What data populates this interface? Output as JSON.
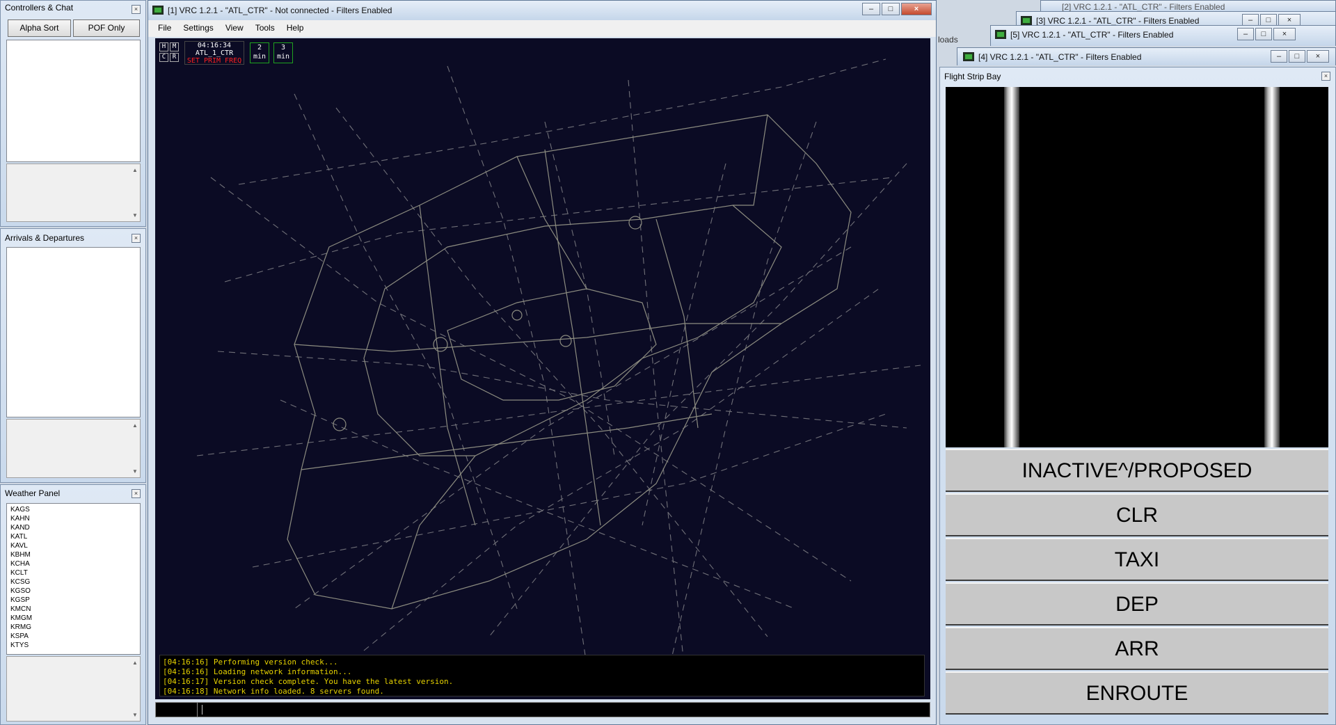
{
  "left_panels": {
    "controllers": {
      "title": "Controllers & Chat",
      "sort_alpha": "Alpha Sort",
      "pof_only": "POF Only"
    },
    "arrivals": {
      "title": "Arrivals & Departures"
    },
    "weather": {
      "title": "Weather Panel",
      "airports": [
        "KAGS",
        "KAHN",
        "KAND",
        "KATL",
        "KAVL",
        "KBHM",
        "KCHA",
        "KCLT",
        "KCSG",
        "KGSO",
        "KGSP",
        "KMCN",
        "KMGM",
        "KRMG",
        "KSPA",
        "KTYS"
      ]
    }
  },
  "main_window": {
    "title": "[1] VRC 1.2.1 - \"ATL_CTR\" - Not connected - Filters Enabled",
    "menu": [
      "File",
      "Settings",
      "View",
      "Tools",
      "Help"
    ],
    "hud": {
      "btn_h": "H",
      "btn_m": "M",
      "btn_c": "C",
      "btn_r": "R",
      "time": "04:16:34",
      "callsign": "ATL_1_CTR",
      "freq_warning": "SET PRIM FREQ",
      "timer1_value": "2",
      "timer1_unit": "min",
      "timer2_value": "3",
      "timer2_unit": "min"
    },
    "messages": [
      "[04:16:16] Performing version check...",
      "[04:16:16] Loading network information...",
      "[04:16:17] Version check complete. You have the latest version.",
      "[04:16:18] Network info loaded. 8 servers found."
    ]
  },
  "background_windows": [
    {
      "title": "[2] VRC 1.2.1 - \"ATL_CTR\" - Filters Enabled"
    },
    {
      "title": "[3] VRC 1.2.1 - \"ATL_CTR\" - Filters Enabled"
    },
    {
      "title": "[5] VRC 1.2.1 - \"ATL_CTR\" - Filters Enabled"
    },
    {
      "title": "[4] VRC 1.2.1 - \"ATL_CTR\" - Filters Enabled"
    }
  ],
  "background_fragment": "loads",
  "flight_strip_bay": {
    "title": "Flight Strip Bay",
    "bays": [
      "INACTIVE^/PROPOSED",
      "CLR",
      "TAXI",
      "DEP",
      "ARR",
      "ENROUTE"
    ]
  },
  "colors": {
    "scope_bg": "#0b0b24",
    "hud_text": "#ffffff",
    "hud_warning": "#ff2020",
    "message_text": "#e6d200",
    "timer_border": "#1fa31f"
  }
}
